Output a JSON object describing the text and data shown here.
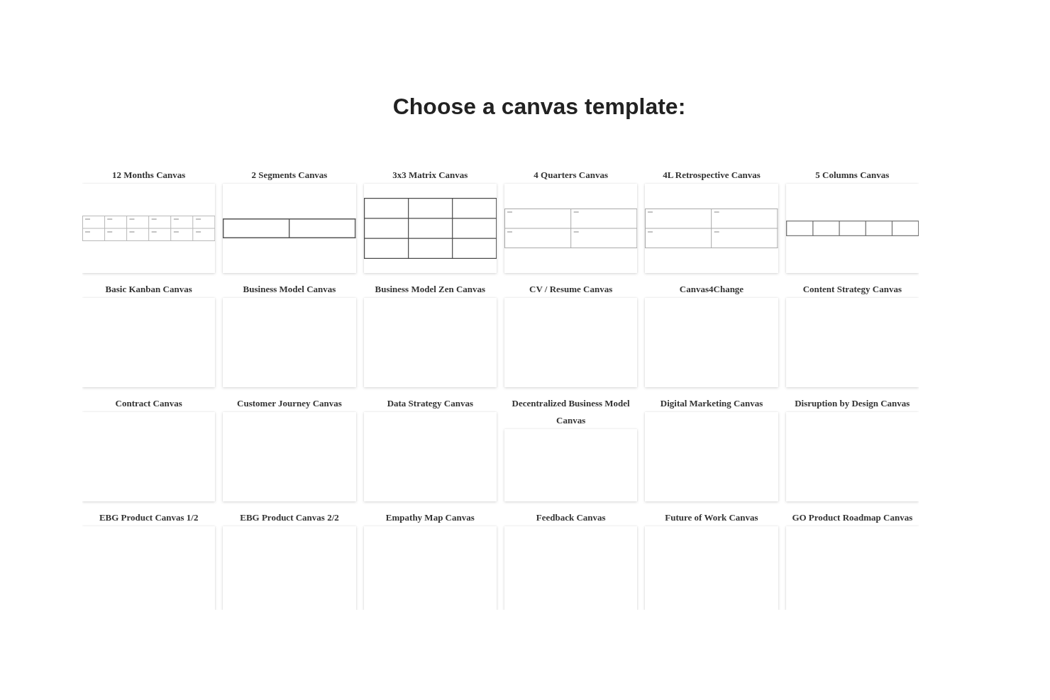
{
  "page": {
    "title": "Choose a canvas template:"
  },
  "templates": [
    {
      "name": "12 Months Canvas",
      "kind": "month-grid"
    },
    {
      "name": "2 Segments Canvas",
      "kind": "two-segments"
    },
    {
      "name": "3x3 Matrix Canvas",
      "kind": "three-by-three"
    },
    {
      "name": "4 Quarters Canvas",
      "kind": "quadrants"
    },
    {
      "name": "4L Retrospective Canvas",
      "kind": "quadrants"
    },
    {
      "name": "5 Columns Canvas",
      "kind": "five-columns"
    },
    {
      "name": "Basic Kanban Canvas",
      "kind": "blank"
    },
    {
      "name": "Business Model Canvas",
      "kind": "blank"
    },
    {
      "name": "Business Model Zen Canvas",
      "kind": "blank"
    },
    {
      "name": "CV / Resume Canvas",
      "kind": "blank"
    },
    {
      "name": "Canvas4Change",
      "kind": "blank"
    },
    {
      "name": "Content Strategy Canvas",
      "kind": "blank"
    },
    {
      "name": "Contract Canvas",
      "kind": "blank"
    },
    {
      "name": "Customer Journey Canvas",
      "kind": "blank"
    },
    {
      "name": "Data Strategy Canvas",
      "kind": "blank"
    },
    {
      "name": "Decentralized Business Model Canvas",
      "kind": "blank"
    },
    {
      "name": "Digital Marketing Canvas",
      "kind": "blank"
    },
    {
      "name": "Disruption by Design Canvas",
      "kind": "blank"
    },
    {
      "name": "EBG Product Canvas 1/2",
      "kind": "blank"
    },
    {
      "name": "EBG Product Canvas 2/2",
      "kind": "blank"
    },
    {
      "name": "Empathy Map Canvas",
      "kind": "blank"
    },
    {
      "name": "Feedback Canvas",
      "kind": "blank"
    },
    {
      "name": "Future of Work Canvas",
      "kind": "blank"
    },
    {
      "name": "GO Product Roadmap Canvas",
      "kind": "blank"
    }
  ]
}
